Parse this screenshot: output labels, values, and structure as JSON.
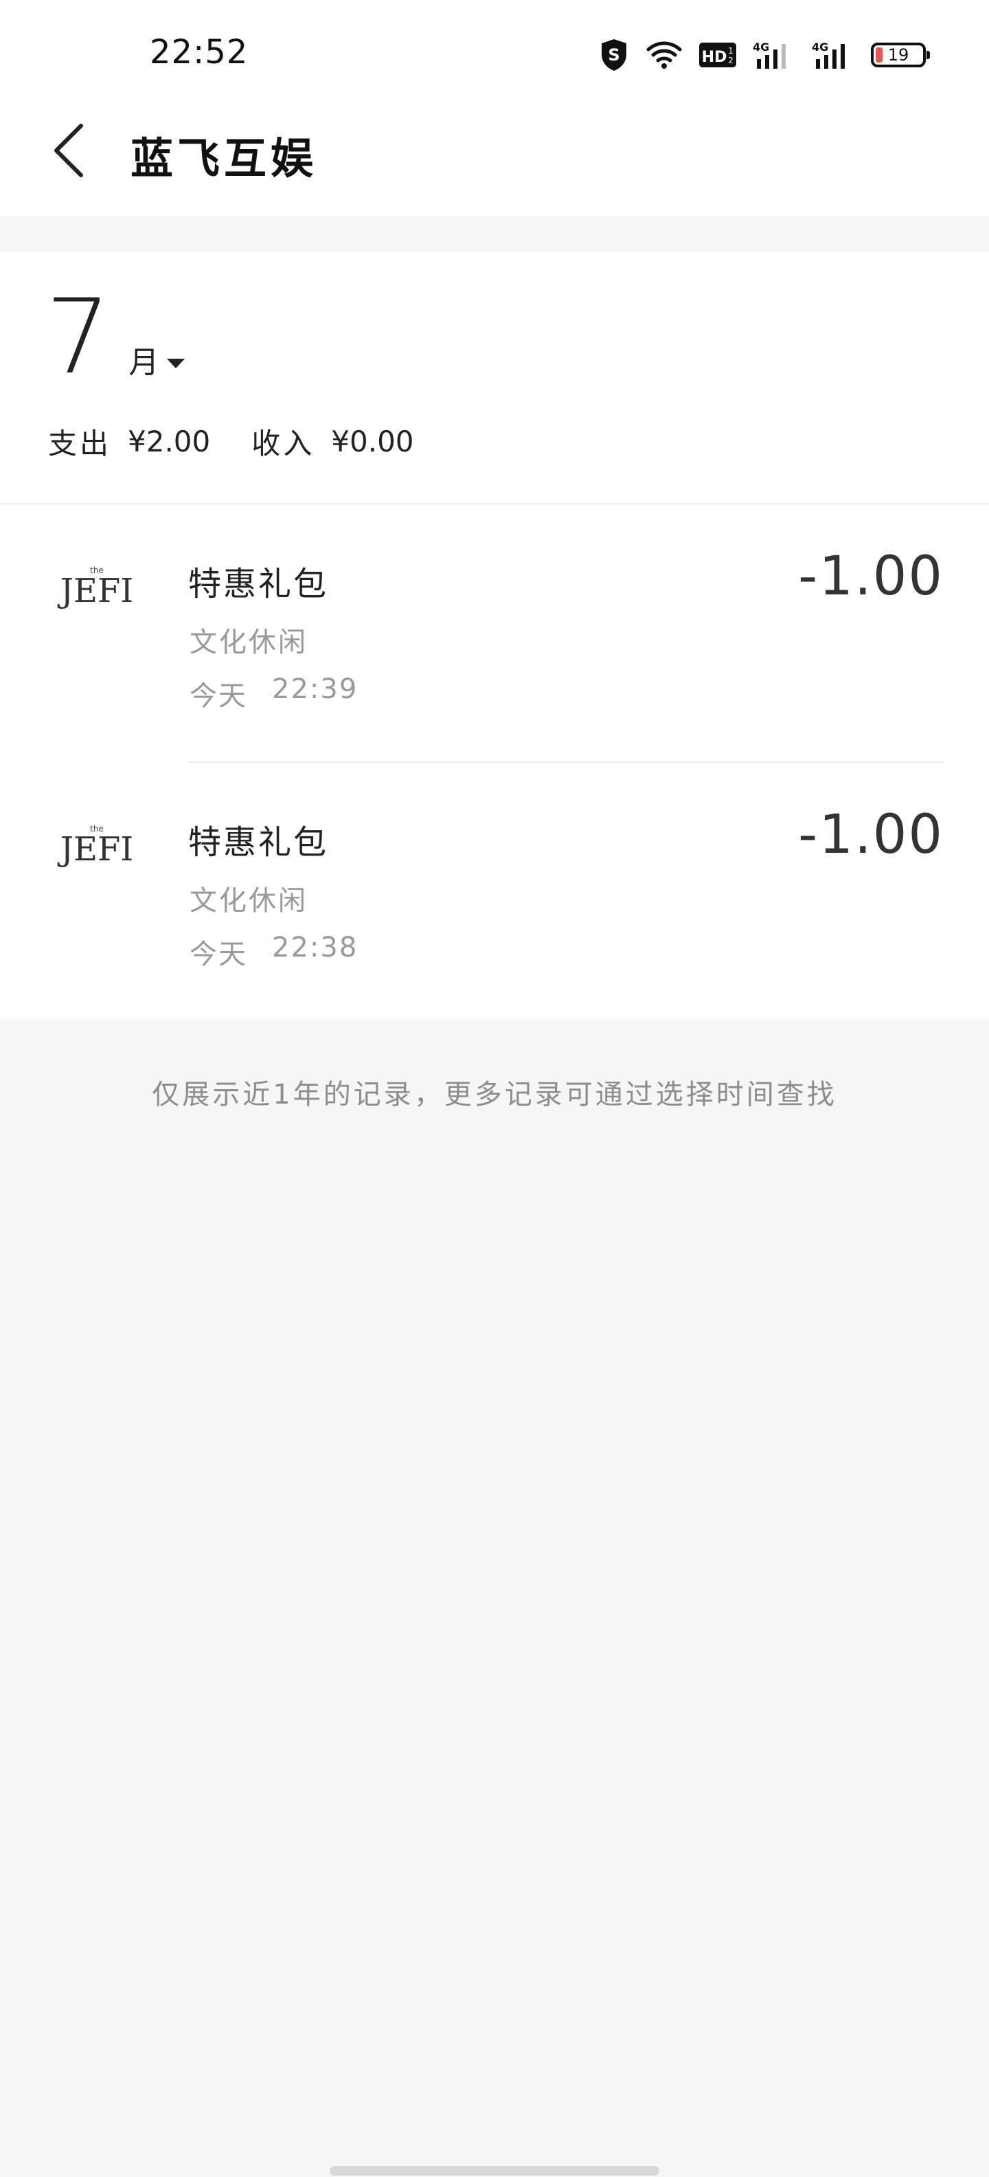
{
  "status_bar": {
    "time": "22:52",
    "battery": "19",
    "icons": [
      "shield-s-icon",
      "wifi-icon",
      "hd-icon",
      "signal-4g-icon",
      "signal-4g-icon",
      "battery-icon"
    ]
  },
  "header": {
    "back_icon": "chevron-left-icon",
    "title": "蓝飞互娱"
  },
  "summary": {
    "month": "7",
    "month_unit": "月",
    "expense_label": "支出",
    "expense_value": "¥2.00",
    "income_label": "收入",
    "income_value": "¥0.00"
  },
  "transactions": [
    {
      "title": "特惠礼包",
      "category": "文化休闲",
      "day": "今天",
      "time": "22:39",
      "amount": "-1.00",
      "logo_text": "JEFI"
    },
    {
      "title": "特惠礼包",
      "category": "文化休闲",
      "day": "今天",
      "time": "22:38",
      "amount": "-1.00",
      "logo_text": "JEFI"
    }
  ],
  "footer_note": "仅展示近1年的记录，更多记录可通过选择时间查找",
  "colors": {
    "background": "#f6f6f6",
    "card": "#ffffff",
    "primary_text": "#222222",
    "secondary_text": "#9a9a9a"
  }
}
